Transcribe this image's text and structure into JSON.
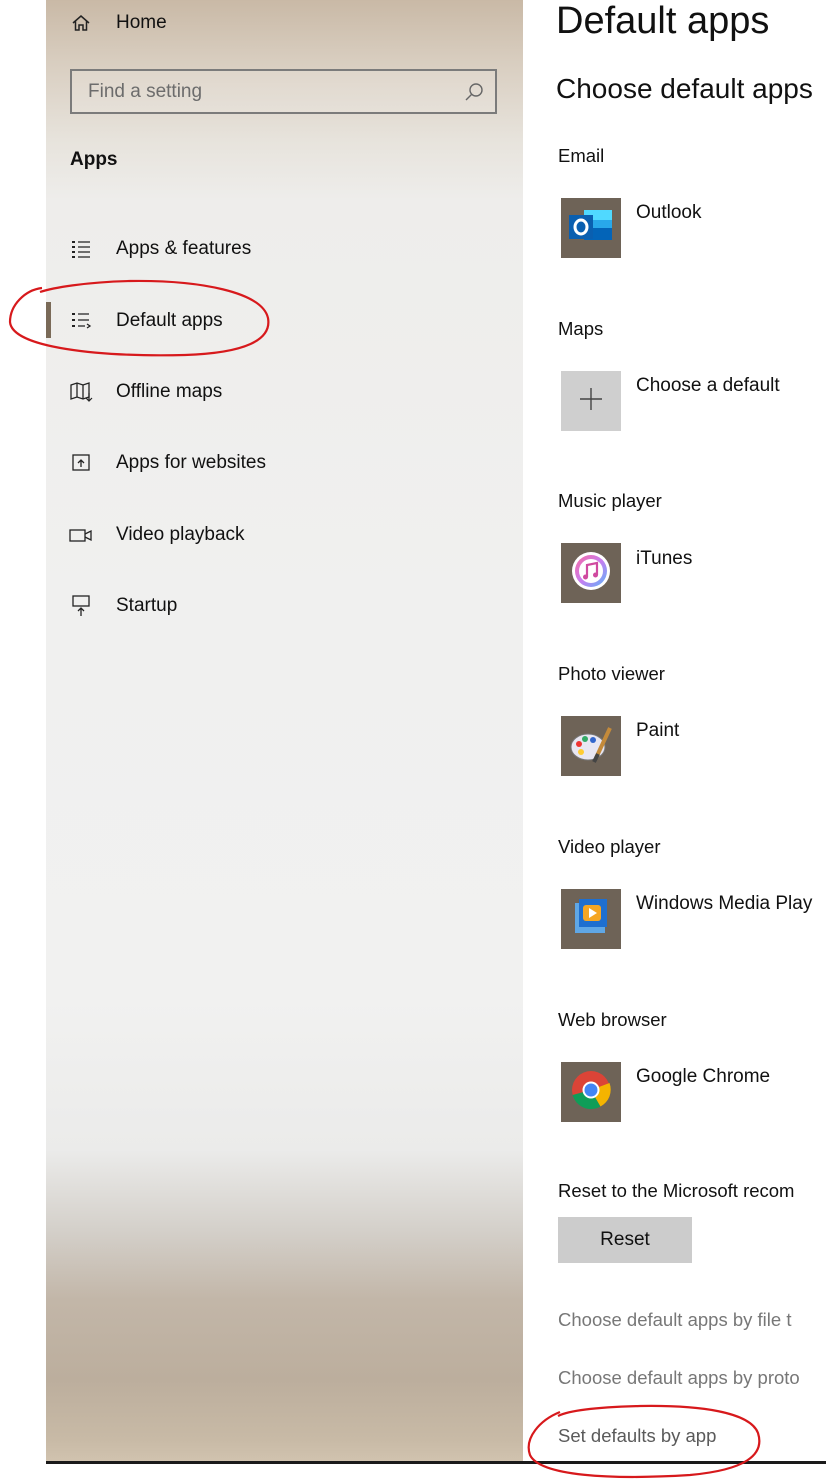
{
  "sidebar": {
    "home_label": "Home",
    "search_placeholder": "Find a setting",
    "section_title": "Apps",
    "items": [
      {
        "label": "Apps & features",
        "icon": "apps-features-icon"
      },
      {
        "label": "Default apps",
        "icon": "default-apps-icon",
        "selected": true
      },
      {
        "label": "Offline maps",
        "icon": "offline-maps-icon"
      },
      {
        "label": "Apps for websites",
        "icon": "apps-for-websites-icon"
      },
      {
        "label": "Video playback",
        "icon": "video-playback-icon"
      },
      {
        "label": "Startup",
        "icon": "startup-icon"
      }
    ]
  },
  "main": {
    "title": "Default apps",
    "subtitle": "Choose default apps",
    "categories": [
      {
        "label": "Email",
        "app": "Outlook",
        "icon": "outlook-icon"
      },
      {
        "label": "Maps",
        "app": "Choose a default",
        "icon": "plus-icon"
      },
      {
        "label": "Music player",
        "app": "iTunes",
        "icon": "itunes-icon"
      },
      {
        "label": "Photo viewer",
        "app": "Paint",
        "icon": "paint-icon"
      },
      {
        "label": "Video player",
        "app": "Windows Media Play",
        "icon": "windows-media-player-icon"
      },
      {
        "label": "Web browser",
        "app": "Google Chrome",
        "icon": "chrome-icon"
      }
    ],
    "reset_text": "Reset to the Microsoft recom",
    "reset_button": "Reset",
    "links": [
      "Choose default apps by file t",
      "Choose default apps by proto",
      "Set defaults by app"
    ]
  },
  "colors": {
    "selection_bar": "#7a6a58",
    "tile_background": "#6e6357",
    "annotation_red": "#d7191c"
  }
}
